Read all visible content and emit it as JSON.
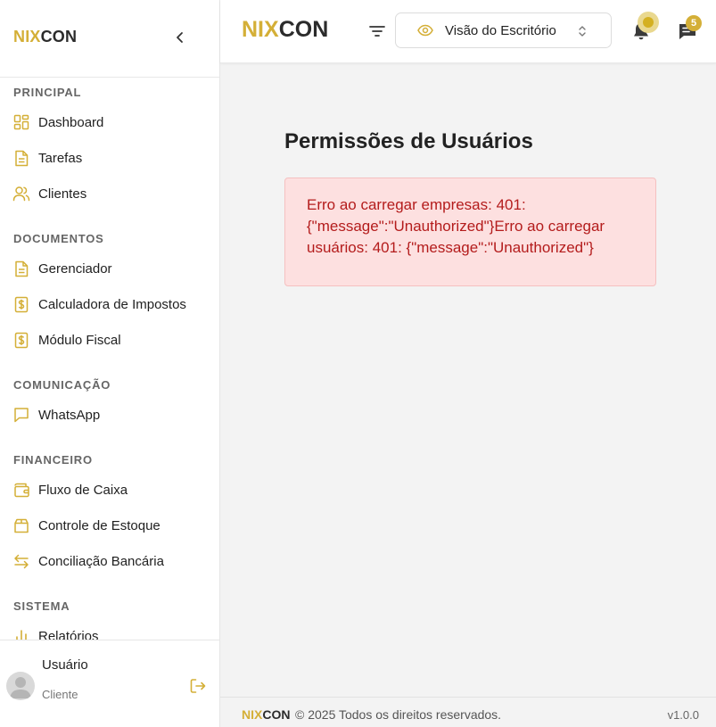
{
  "brand": {
    "part1": "NIX",
    "part2": "CON"
  },
  "colors": {
    "accent": "#d4af37",
    "error_text": "#b41c1c",
    "error_bg": "#fde0e0"
  },
  "sidebar": {
    "sections": [
      {
        "label": "PRINCIPAL"
      },
      {
        "label": "DOCUMENTOS"
      },
      {
        "label": "COMUNICAÇÃO"
      },
      {
        "label": "FINANCEIRO"
      },
      {
        "label": "SISTEMA"
      }
    ],
    "items": [
      {
        "label": "Dashboard",
        "icon": "grid-icon"
      },
      {
        "label": "Tarefas",
        "icon": "file-icon"
      },
      {
        "label": "Clientes",
        "icon": "users-icon"
      },
      {
        "label": "Gerenciador",
        "icon": "file-icon"
      },
      {
        "label": "Calculadora de Impostos",
        "icon": "dollar-file-icon"
      },
      {
        "label": "Módulo Fiscal",
        "icon": "dollar-file-icon"
      },
      {
        "label": "WhatsApp",
        "icon": "message-icon"
      },
      {
        "label": "Fluxo de Caixa",
        "icon": "wallet-icon"
      },
      {
        "label": "Controle de Estoque",
        "icon": "box-icon"
      },
      {
        "label": "Conciliação Bancária",
        "icon": "arrows-icon"
      },
      {
        "label": "Relatórios",
        "icon": "bar-chart-icon"
      }
    ]
  },
  "user": {
    "name": "Usuário",
    "role": "Cliente"
  },
  "header": {
    "view_select": "Visão do Escritório",
    "chat_badge": "5"
  },
  "main": {
    "title": "Permissões de Usuários",
    "error_message": "Erro ao carregar empresas: 401: {\"message\":\"Unauthorized\"}Erro ao carregar usuários: 401: {\"message\":\"Unauthorized\"}"
  },
  "footer": {
    "copyright": "© 2025 Todos os direitos reservados.",
    "version": "v1.0.0"
  }
}
